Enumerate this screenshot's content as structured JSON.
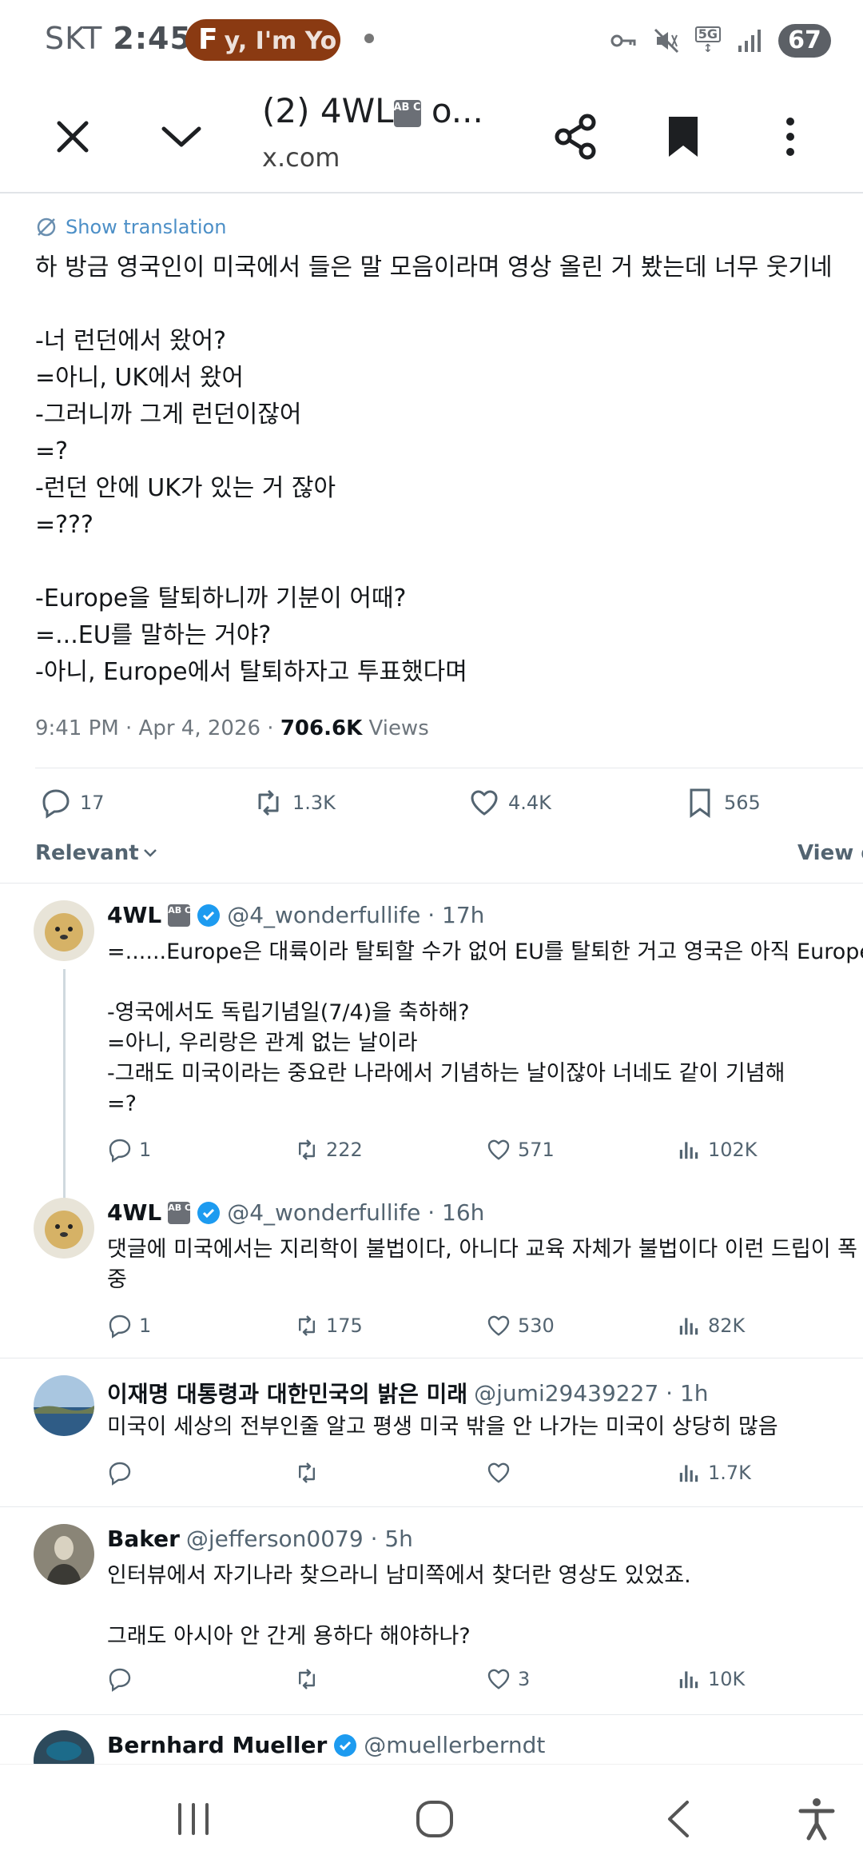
{
  "status_bar": {
    "carrier": "SKT",
    "time": "2:45",
    "pill_text": "y, I'm Yo",
    "network": "5G",
    "battery": "67"
  },
  "browser": {
    "tab_title": "(2) 4WL",
    "title_suffix": " o...",
    "abcd_text": "AB CD",
    "domain": "x.com"
  },
  "tweet": {
    "show_translation": "Show translation",
    "text": "하 방금 영국인이 미국에서 들은 말 모음이라며 영상 올린 거 봤는데 너무 웃기네\n\n-너 런던에서 왔어?\n=아니, UK에서 왔어\n-그러니까 그게 런던이잖어\n=?\n-런던 안에 UK가 있는 거 잖아\n=???\n\n-Europe을 탈퇴하니까 기분이 어때?\n=...EU를 말하는 거야?\n-아니, Europe에서 탈퇴하자고 투표했다며",
    "time": "9:41 PM · Apr 4, 2026 · ",
    "views_count": "706.6K",
    "views_label": " Views",
    "replies": "17",
    "retweets": "1.3K",
    "likes": "4.4K",
    "bookmarks": "565"
  },
  "sort": {
    "label": "Relevant",
    "view_quotes": "View q"
  },
  "replies": [
    {
      "name": "4WL",
      "handle": "@4_wonderfullife · 17h",
      "text": "=......Europe은 대륙이라 탈퇴할 수가 없어 EU를 탈퇴한 거고 영국은 아직 Europe이\n\n-영국에서도 독립기념일(7/4)을 축하해?\n=아니, 우리랑은 관계 없는 날이라\n-그래도 미국이라는 중요란 나라에서 기념하는 날이잖아 너네도 같이 기념해\n=?",
      "replies": "1",
      "retweets": "222",
      "likes": "571",
      "views": "102K"
    },
    {
      "name": "4WL",
      "handle": "@4_wonderfullife · 16h",
      "text": "댓글에 미국에서는 지리학이 불법이다, 아니다 교육 자체가 불법이다 이런 드립이 폭\n중",
      "replies": "1",
      "retweets": "175",
      "likes": "530",
      "views": "82K"
    },
    {
      "name": "이재명 대통령과 대한민국의 밝은 미래",
      "handle": "@jumi29439227 · 1h",
      "text": "미국이 세상의 전부인줄 알고 평생 미국 밖을 안 나가는 미국이 상당히 많음",
      "replies": "",
      "retweets": "",
      "likes": "",
      "views": "1.7K"
    },
    {
      "name": "Baker",
      "handle": "@jefferson0079 · 5h",
      "text": "인터뷰에서 자기나라 찾으라니 남미쪽에서 찾더란 영상도 있었죠.\n\n그래도 아시아 안 간게 용하다 해야하나?",
      "replies": "",
      "retweets": "",
      "likes": "3",
      "views": "10K"
    },
    {
      "name": "Bernhard Mueller",
      "handle": "@muellerberndt"
    }
  ],
  "colors": {
    "link_blue": "#4c8fc7",
    "verified_blue": "#1d9bf0",
    "muted": "#536471"
  }
}
